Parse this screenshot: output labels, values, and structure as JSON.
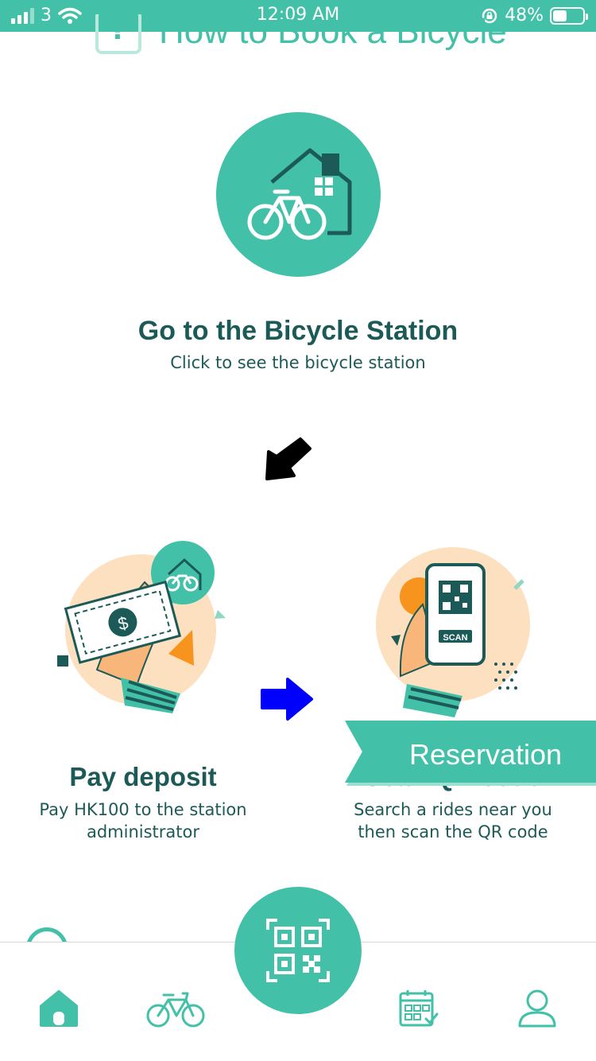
{
  "status_bar": {
    "carrier": "3",
    "time": "12:09 AM",
    "battery_percent": "48%",
    "battery_level": 0.48,
    "icons": [
      "signal-icon",
      "wifi-icon",
      "rotation-lock-icon",
      "battery-icon"
    ]
  },
  "header": {
    "title": "How to Book a Bicycle",
    "icon": "question-icon"
  },
  "step1": {
    "title": "Go to the Bicycle Station",
    "subtitle": "Click to see the bicycle station",
    "icon": "bicycle-station-icon"
  },
  "step2": {
    "title": "Pay deposit",
    "subtitle_line1": "Pay HK100 to the station",
    "subtitle_line2": "administrator",
    "icon": "pay-deposit-illustration"
  },
  "step3": {
    "title": "Scan QR code",
    "subtitle_line1": "Search a rides near you",
    "subtitle_line2": "then scan the QR code",
    "scan_label": "SCAN",
    "icon": "scan-phone-illustration"
  },
  "reservation_button": {
    "label": "Reservation"
  },
  "bottom_nav": {
    "items": [
      {
        "name": "home",
        "icon": "home-icon"
      },
      {
        "name": "bicycle",
        "icon": "bicycle-icon"
      },
      {
        "name": "scan",
        "icon": "qr-code-icon"
      },
      {
        "name": "reservations",
        "icon": "calendar-check-icon"
      },
      {
        "name": "profile",
        "icon": "user-icon"
      }
    ]
  },
  "colors": {
    "brand": "#42c1a8",
    "text_dark": "#1c5a57",
    "illustration_peach": "#fde0bf",
    "illustration_orange": "#f7941d",
    "arrow_blue": "#0000ff"
  }
}
